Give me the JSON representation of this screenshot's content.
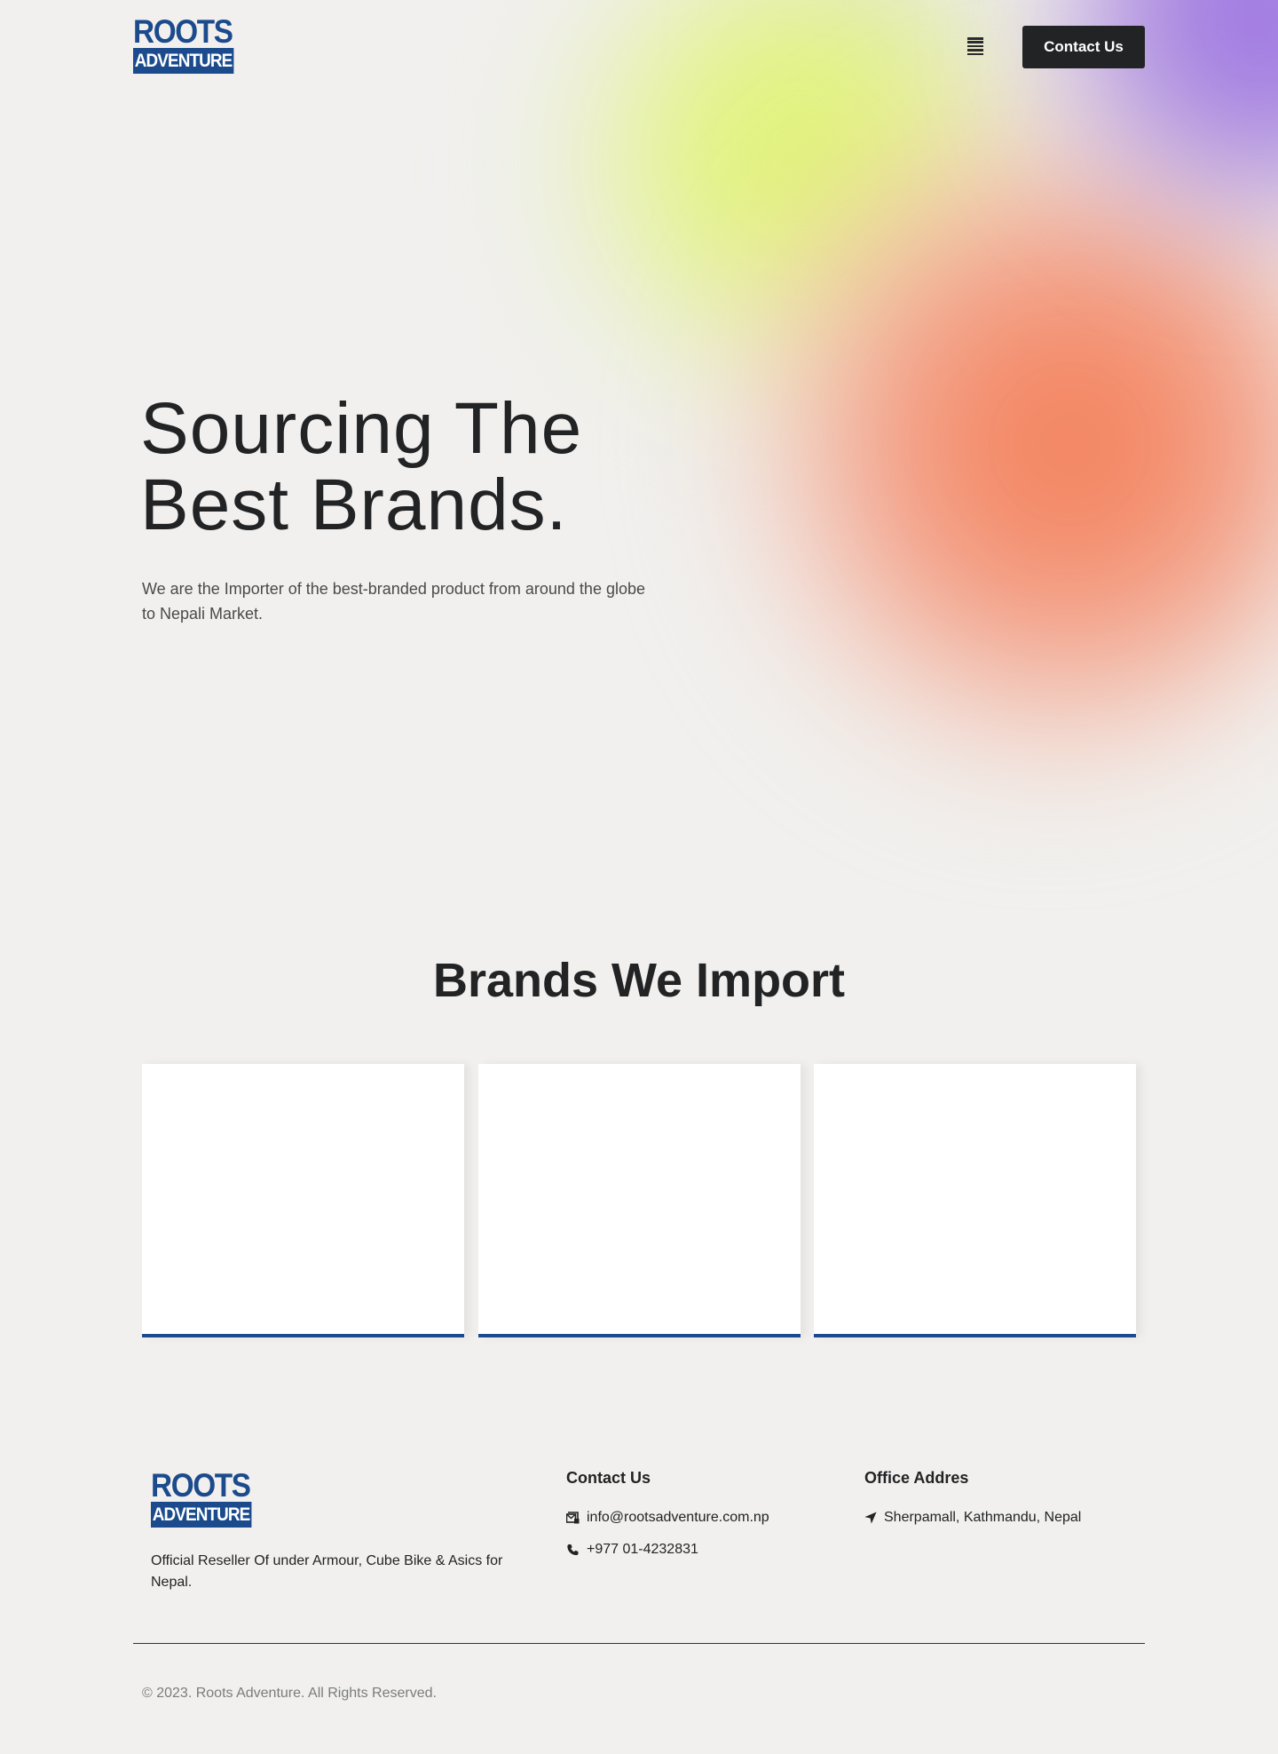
{
  "header": {
    "logo_line1": "ROOTS",
    "logo_line2": "ADVENTURE",
    "menu_icon": "hamburger-menu-icon",
    "contact_button": "Contact Us"
  },
  "hero": {
    "title_line1": "Sourcing The",
    "title_line2": "Best Brands.",
    "subtitle_line1": "We are the Importer of the best-branded product from around the globe",
    "subtitle_line2": "to Nepali Market."
  },
  "brands": {
    "title": "Brands We Import",
    "card_count": 3
  },
  "footer": {
    "logo_line1": "ROOTS",
    "logo_line2": "ADVENTURE",
    "description_line1": "Official Reseller Of under Armour, Cube Bike & Asics for",
    "description_line2": "Nepal.",
    "contact_title": "Contact Us",
    "email": "info@rootsadventure.com.np",
    "phone": "+977 01-4232831",
    "office_title": "Office Addres",
    "address": "Sherpamall, Kathmandu, Nepal",
    "copyright": "© 2023. Roots Adventure. All Rights Reserved."
  },
  "colors": {
    "background": "#f1f0ee",
    "brand_blue": "#1b4b8c",
    "dark": "#222325"
  }
}
